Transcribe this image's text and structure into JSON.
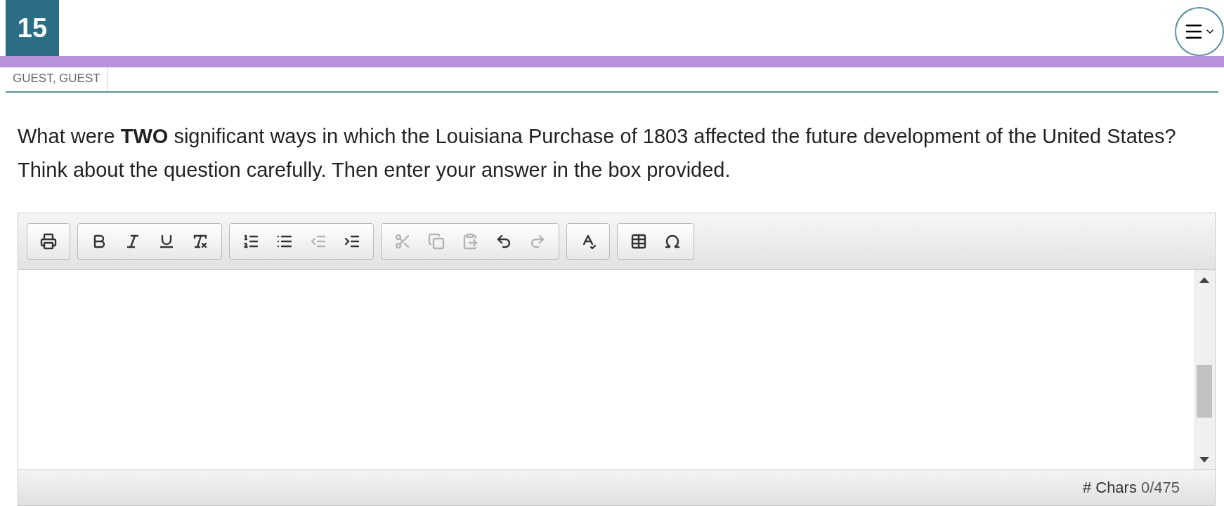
{
  "header": {
    "question_number": "15",
    "user": "GUEST, GUEST"
  },
  "question": {
    "prompt": "What were **TWO** significant ways in which the Louisiana Purchase of 1803 affected the future development of the United States?",
    "instruction": "Think about the question carefully. Then enter your answer in the box provided."
  },
  "toolbar": [
    [
      {
        "kind": "print",
        "disabled": false
      }
    ],
    [
      {
        "kind": "bold",
        "disabled": false
      },
      {
        "kind": "italic",
        "disabled": false
      },
      {
        "kind": "underline",
        "disabled": false
      },
      {
        "kind": "clear-format",
        "disabled": false
      }
    ],
    [
      {
        "kind": "numbered-list",
        "disabled": false
      },
      {
        "kind": "bulleted-list",
        "disabled": false
      },
      {
        "kind": "outdent",
        "disabled": true
      },
      {
        "kind": "indent",
        "disabled": false
      }
    ],
    [
      {
        "kind": "cut",
        "disabled": true
      },
      {
        "kind": "copy",
        "disabled": true
      },
      {
        "kind": "paste",
        "disabled": true
      },
      {
        "kind": "undo",
        "disabled": false
      },
      {
        "kind": "redo",
        "disabled": true
      }
    ],
    [
      {
        "kind": "spellcheck",
        "disabled": false
      }
    ],
    [
      {
        "kind": "table",
        "disabled": false
      },
      {
        "kind": "special-character",
        "disabled": false
      }
    ]
  ],
  "char_count": {
    "label": "# Chars",
    "value": "0/475"
  }
}
